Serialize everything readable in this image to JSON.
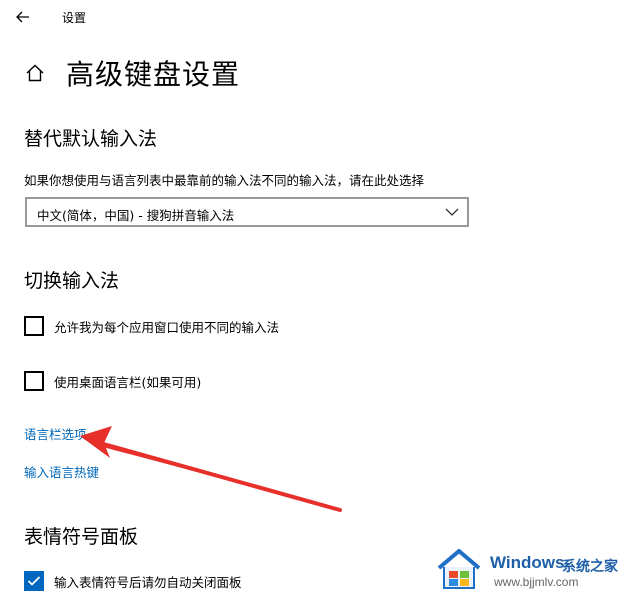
{
  "window": {
    "app_title": "设置"
  },
  "header": {
    "title": "高级键盘设置"
  },
  "override_section": {
    "heading": "替代默认输入法",
    "description": "如果你想使用与语言列表中最靠前的输入法不同的输入法，请在此处选择",
    "dropdown_value": "中文(简体，中国) - 搜狗拼音输入法"
  },
  "switch_section": {
    "heading": "切换输入法",
    "checkbox_per_app": {
      "label": "允许我为每个应用窗口使用不同的输入法",
      "checked": false
    },
    "checkbox_language_bar": {
      "label": "使用桌面语言栏(如果可用)",
      "checked": false
    },
    "link_language_bar_options": "语言栏选项",
    "link_input_hotkeys": "输入语言热键"
  },
  "emoji_section": {
    "heading": "表情符号面板",
    "checkbox_auto_close": {
      "label": "输入表情符号后请勿自动关闭面板",
      "checked": true
    }
  },
  "watermark": {
    "brand": "Windows",
    "brand_cn": "系统之家",
    "url": "www.bjjmlv.com"
  },
  "colors": {
    "link": "#0067b8",
    "accent": "#0067c0",
    "annotation_arrow": "#e8302a"
  },
  "icons": {
    "back": "back-arrow-icon",
    "home": "home-icon",
    "dropdown": "chevron-down-icon",
    "check": "checkmark-icon"
  }
}
